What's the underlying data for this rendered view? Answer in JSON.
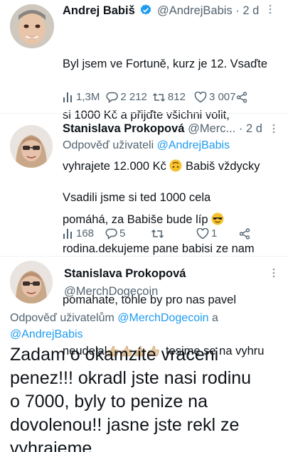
{
  "tweet1": {
    "name": "Andrej Babiš",
    "handle": "@AndrejBabis",
    "time": "· 2 d",
    "text_line1": "Byl jsem ve Fortuně, kurz je 12. Vsaďte",
    "text_line2": "si 1000 Kč a přijďte všichni volit,",
    "text_line3a": "vyhrajete 12.000 Kč ",
    "text_line3b": " Babiš vždycky",
    "text_line4a": "pomáhá, za Babiše bude líp ",
    "views": "1,3M",
    "replies": "2 212",
    "retweets": "812",
    "likes": "3 007",
    "verified_color": "#1d9bf0",
    "icons": [
      "verified-badge-icon",
      "more-icon",
      "views-icon",
      "reply-icon",
      "retweet-icon",
      "like-icon",
      "share-icon",
      "upside-down-face-emoji",
      "sunglasses-emoji"
    ]
  },
  "tweet2": {
    "name": "Stanislava Prokopová",
    "handle": "@Merc...",
    "time": "· 2 d",
    "reply_prefix": "Odpověď uživateli ",
    "reply_mention": "@AndrejBabis",
    "text_line1": "Vsadili jsme si ted 1000 cela",
    "text_line2": "rodina.dekujeme pane babisi ze nam",
    "text_line3": "pomahate, tohle by pro nas pavel",
    "text_line4a": "neudelal",
    "text_line4b": " tesime se na vyhru",
    "views": "168",
    "replies": "5",
    "likes": "1",
    "icons": [
      "thumbs-up-emoji",
      "views-icon",
      "reply-icon",
      "retweet-icon",
      "like-icon",
      "share-icon"
    ]
  },
  "tweet3": {
    "name": "Stanislava Prokopová",
    "handle": "@MerchDogecoin",
    "reply_prefix": "Odpověď uživatelům ",
    "reply_mention1": "@MerchDogecoin",
    "reply_and": " a",
    "reply_mention2": "@AndrejBabis",
    "text_line1": "Zadam o okamzite vraceni",
    "text_line2": "penez!!! okradl jste nasi rodinu",
    "text_line3": "o 7000, byly to penize na",
    "text_line4": "dovolenou!! jasne jste rekl ze",
    "text_line5": "vyhrajeme"
  }
}
